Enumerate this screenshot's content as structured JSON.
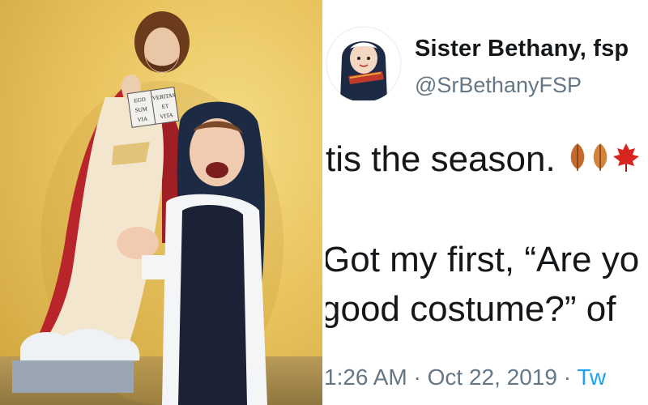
{
  "tweet": {
    "display_name": "Sister Bethany, fsp",
    "handle": "@SrBethanyFSP",
    "line1": "tis the season.",
    "line2": "Got my first, “Are yo",
    "line3": "good costume?” of",
    "timestamp": "1:26 AM · Oct 22, 2019 ·",
    "source": "Tw",
    "emoji": [
      "fallen-leaf-icon",
      "fallen-leaf-icon",
      "maple-leaf-icon"
    ]
  },
  "photo": {
    "book_text": [
      "EGO",
      "VERITAS",
      "SUM",
      "ET",
      "VIA",
      "VITA"
    ]
  },
  "colors": {
    "text": "#14171a",
    "secondary": "#657786",
    "link": "#1da1f2"
  }
}
